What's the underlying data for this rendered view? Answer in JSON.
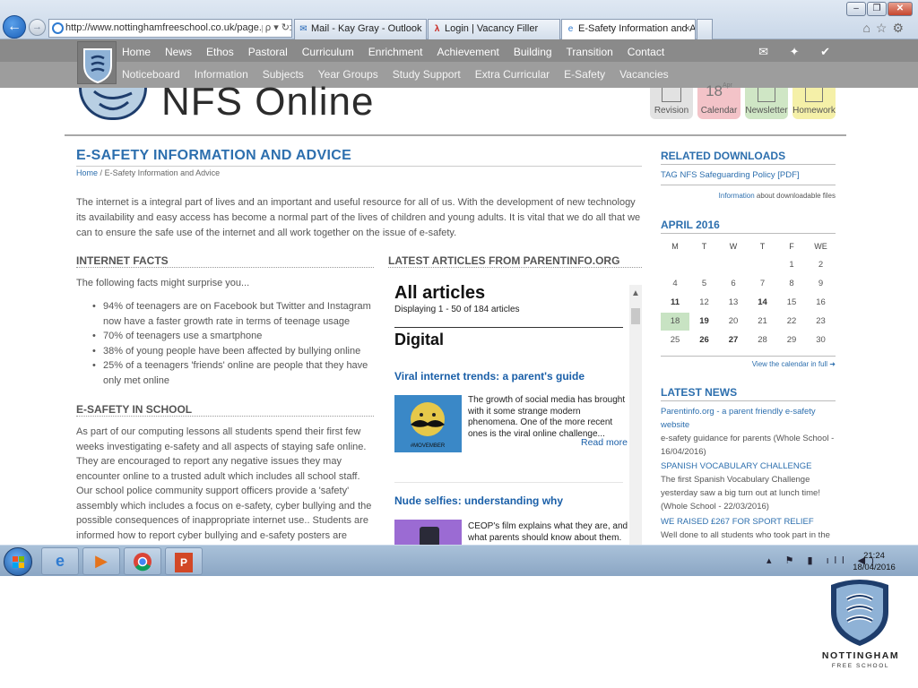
{
  "browser": {
    "url": "http://www.nottinghamfreeschool.co.uk/page.php?p:",
    "url_tools": "ρ ▾ ↻",
    "tabs": [
      {
        "label": "Mail - Kay Gray - Outlook"
      },
      {
        "label": "Login | Vacancy Filler"
      },
      {
        "label": "E-Safety Information and A..."
      }
    ],
    "window_controls": [
      "–",
      "❐",
      "✕"
    ],
    "right_icons": "⌂☆⚙"
  },
  "nav": {
    "primary": [
      "Home",
      "News",
      "Ethos",
      "Pastoral",
      "Curriculum",
      "Enrichment",
      "Achievement",
      "Building",
      "Transition",
      "Contact"
    ],
    "secondary": [
      "Noticeboard",
      "Information",
      "Subjects",
      "Year Groups",
      "Study Support",
      "Extra Curricular",
      "E-Safety",
      "Vacancies"
    ],
    "social": "✉ ✦ ✔"
  },
  "header": {
    "site_title": "NFS Online",
    "tiles": [
      {
        "label": "Revision",
        "color": "#e2e2e2"
      },
      {
        "label": "Calendar",
        "color": "#f3c3c8",
        "date_num": "18",
        "date_mon": "Apr"
      },
      {
        "label": "Newsletter",
        "color": "#cfe6c5"
      },
      {
        "label": "Homework",
        "color": "#f5f0a8"
      }
    ]
  },
  "content": {
    "title": "E-SAFETY INFORMATION AND ADVICE",
    "breadcrumb_home": "Home",
    "breadcrumb_sep": "/",
    "breadcrumb_current": "E-Safety Information and Advice",
    "intro": "The internet is a integral part of lives and an important and useful resource for all of us. With the development of new technology its availability and easy access has become a normal part of the lives of children and young adults. It is vital that we do all that we can to ensure the safe use of the internet and all work together on the issue of e-safety.",
    "facts_heading": "INTERNET FACTS",
    "facts_intro": "The following facts might surprise you...",
    "facts": [
      "94% of teenagers are on Facebook but Twitter and Instagram now have a faster growth rate in terms of teenage usage",
      "70% of teenagers use a smartphone",
      "38% of young people have been affected by bullying online",
      "25% of a teenagers 'friends' online are people that they have only met online"
    ],
    "school_heading": "E-SAFETY IN SCHOOL",
    "school_text": "As part of our computing lessons all students spend their first few weeks investigating e-safety and all aspects of staying safe online. They are encouraged to report any negative issues they may encounter online to a trusted adult which includes all school staff. Our school police community support officers provide a 'safety' assembly which includes a focus on e-safety, cyber bullying and the possible consequences of inappropriate internet use.. Students are informed how to report cyber bullying and e-safety posters are displayed in prominent positions around school.",
    "articles_heading": "LATEST ARTICLES FROM PARENTINFO.ORG"
  },
  "embed": {
    "heading": "All articles",
    "displaying": "Displaying 1 - 50 of 184 articles",
    "section": "Digital",
    "articles": [
      {
        "title": "Viral internet trends: a parent's guide",
        "text": "The growth of social media has brought with it some strange modern phenomena. One of the more recent ones is the viral online challenge...",
        "img_label": "#MOVEMBER"
      },
      {
        "title": "Nude selfies: understanding why",
        "text": "CEOP's film explains what they are, and what parents should know about them."
      }
    ],
    "read_more": "Read more"
  },
  "sidebar": {
    "downloads_heading": "RELATED DOWNLOADS",
    "download_link": "TAG NFS Safeguarding Policy [PDF]",
    "info_link": "Information",
    "info_text": "about downloadable files",
    "calendar_heading": "APRIL 2016",
    "calendar_days": [
      "M",
      "T",
      "W",
      "T",
      "F",
      "WE"
    ],
    "calendar_rows": [
      [
        "",
        "",
        "",
        "",
        "1",
        "2"
      ],
      [
        "4",
        "5",
        "6",
        "7",
        "8",
        "9"
      ],
      [
        "11",
        "12",
        "13",
        "14",
        "15",
        "16"
      ],
      [
        "18",
        "19",
        "20",
        "21",
        "22",
        "23"
      ],
      [
        "25",
        "26",
        "27",
        "28",
        "29",
        "30"
      ]
    ],
    "calendar_link": "View the calendar in full ➜",
    "news_heading": "LATEST NEWS",
    "news": [
      {
        "title": "Parentinfo.org - a parent friendly e-safety website",
        "text": "e-safety guidance for parents (Whole School - 16/04/2016)"
      },
      {
        "title": "SPANISH VOCABULARY CHALLENGE",
        "text": "The first Spanish Vocabulary Challenge yesterday saw a big turn out at lunch time! (Whole School - 22/03/2016)"
      },
      {
        "title": "WE RAISED £267 FOR SPORT RELIEF",
        "text": "Well done to all students who took part in the"
      }
    ]
  },
  "taskbar": {
    "tray": "▴ ⚑ ▮ ıll ◀)",
    "time": "21:24",
    "date": "18/04/2016"
  },
  "logo": {
    "name": "NOTTINGHAM",
    "sub": "FREE SCHOOL"
  }
}
